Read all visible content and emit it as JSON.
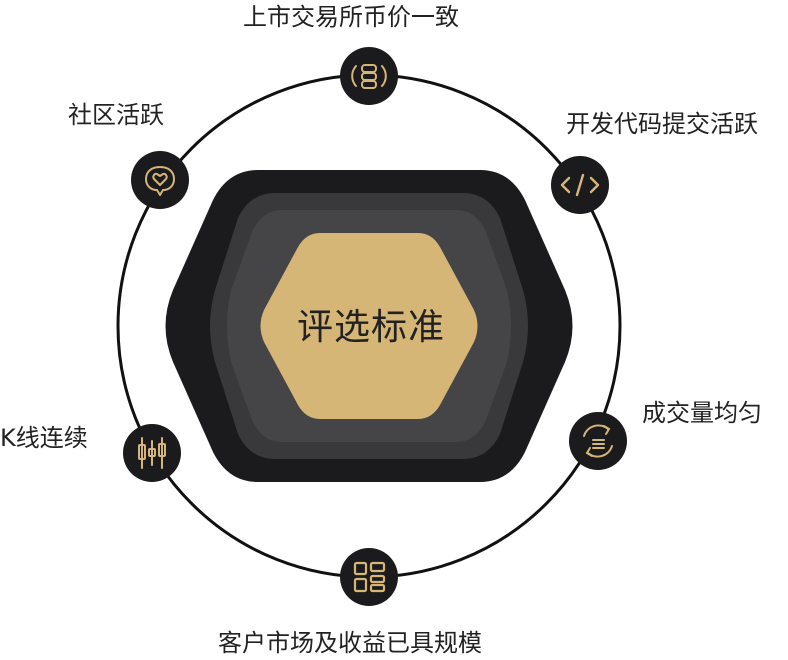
{
  "center_label": "评选标准",
  "criteria": [
    {
      "label": "上市交易所币价一致",
      "icon": "coin-stack-icon"
    },
    {
      "label": "开发代码提交活跃",
      "icon": "code-icon"
    },
    {
      "label": "成交量均匀",
      "icon": "volume-cycle-icon"
    },
    {
      "label": "客户市场及收益已具规模",
      "icon": "grid-icon"
    },
    {
      "label": "K线连续",
      "icon": "candlestick-icon"
    },
    {
      "label": "社区活跃",
      "icon": "chat-heart-icon"
    }
  ],
  "colors": {
    "gold": "#d6b677",
    "dark": "#1b1b1d",
    "mid": "#39393b",
    "inner": "#454547",
    "ring": "#111111"
  }
}
